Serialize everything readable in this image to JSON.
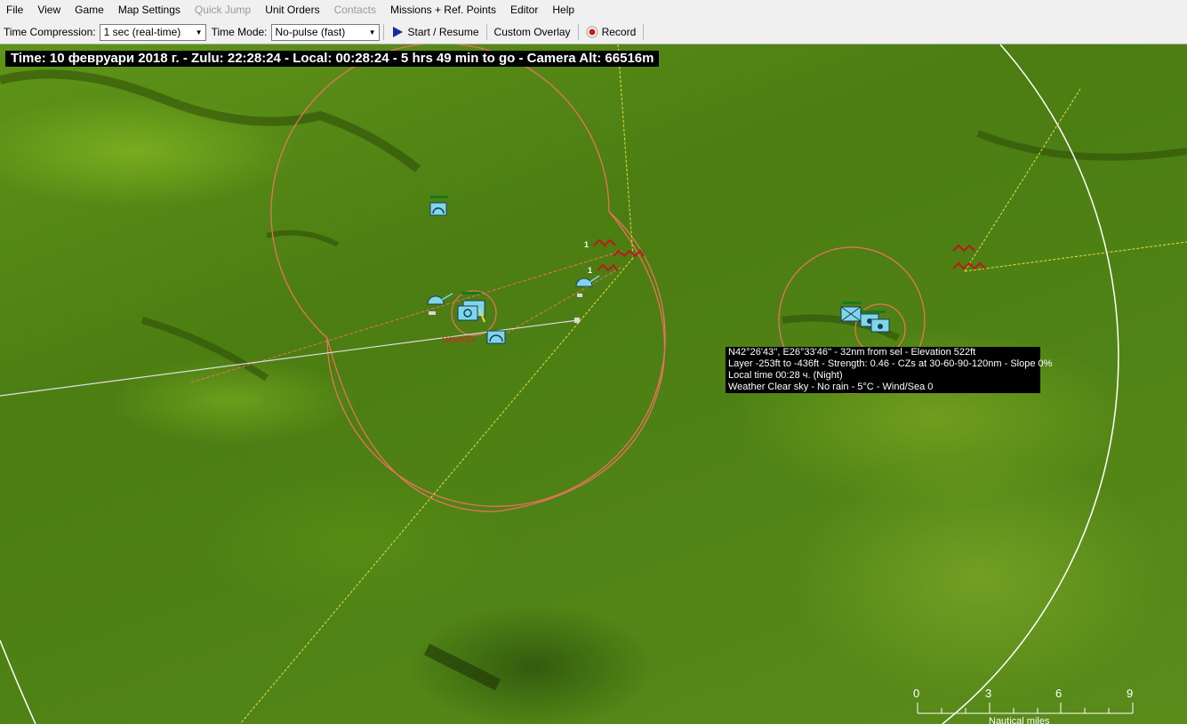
{
  "menu": {
    "items": [
      {
        "label": "File",
        "enabled": true
      },
      {
        "label": "View",
        "enabled": true
      },
      {
        "label": "Game",
        "enabled": true
      },
      {
        "label": "Map Settings",
        "enabled": true
      },
      {
        "label": "Quick Jump",
        "enabled": false
      },
      {
        "label": "Unit Orders",
        "enabled": true
      },
      {
        "label": "Contacts",
        "enabled": false
      },
      {
        "label": "Missions + Ref. Points",
        "enabled": true
      },
      {
        "label": "Editor",
        "enabled": true
      },
      {
        "label": "Help",
        "enabled": true
      }
    ]
  },
  "toolbar": {
    "time_compression_label": "Time Compression:",
    "time_compression_value": "1 sec (real-time)",
    "time_mode_label": "Time Mode:",
    "time_mode_value": "No-pulse (fast)",
    "start_resume_label": "Start / Resume",
    "custom_overlay_label": "Custom Overlay",
    "record_label": "Record",
    "play_icon": "play-icon",
    "record_icon": "record-icon"
  },
  "status": {
    "time_text": "Time: 10 февруари 2018 г. - Zulu: 22:28:24 - Local: 00:28:24 - 5 hrs 49 min to go -  Camera Alt: 66516m"
  },
  "tooltip": {
    "lines": [
      "N42°26'43'', E26°33'46'' - 32nm from sel - Elevation 522ft",
      "Layer -253ft to -436ft - Strength: 0.46 - CZs at 30-60-90-120nm - Slope 0%",
      "Local time 00:28 ч. (Night)",
      "Weather Clear sky - No rain - 5°C - Wind/Sea 0"
    ]
  },
  "map_labels": {
    "group_count_a": "1",
    "group_count_b": "1",
    "unit_label_red": "HAWKEY"
  },
  "scale_bar": {
    "ticks": [
      "0",
      "3",
      "6",
      "9"
    ],
    "unit": "Nautical miles"
  },
  "colors": {
    "range_ring": "#e8735a",
    "friendly_unit": "#7fd6ea",
    "hostile_unit": "#c01818",
    "bearing_yellow": "#e8e040",
    "terrain_green": "#4f8215",
    "menu_bg": "#f0f0f0"
  }
}
